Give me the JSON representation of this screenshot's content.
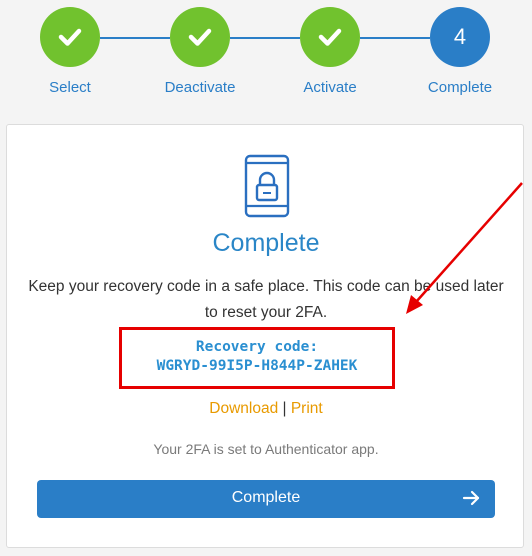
{
  "stepper": {
    "steps": [
      {
        "label": "Select",
        "state": "done"
      },
      {
        "label": "Deactivate",
        "state": "done"
      },
      {
        "label": "Activate",
        "state": "done"
      },
      {
        "label": "Complete",
        "state": "current",
        "number": "4"
      }
    ]
  },
  "card": {
    "icon": "phone-lock-icon",
    "title": "Complete",
    "description": "Keep your recovery code in a safe place. This code can be used later to reset your 2FA.",
    "recovery": {
      "label": "Recovery code:",
      "code": "WGRYD-99I5P-H844P-ZAHEK"
    },
    "links": {
      "download": "Download",
      "separator": " | ",
      "print": "Print"
    },
    "status": "Your 2FA is set to Authenticator app.",
    "button_label": "Complete"
  },
  "colors": {
    "done": "#71c22e",
    "accent": "#2a7ec7",
    "link": "#e89a00",
    "annotation": "#e60000"
  }
}
